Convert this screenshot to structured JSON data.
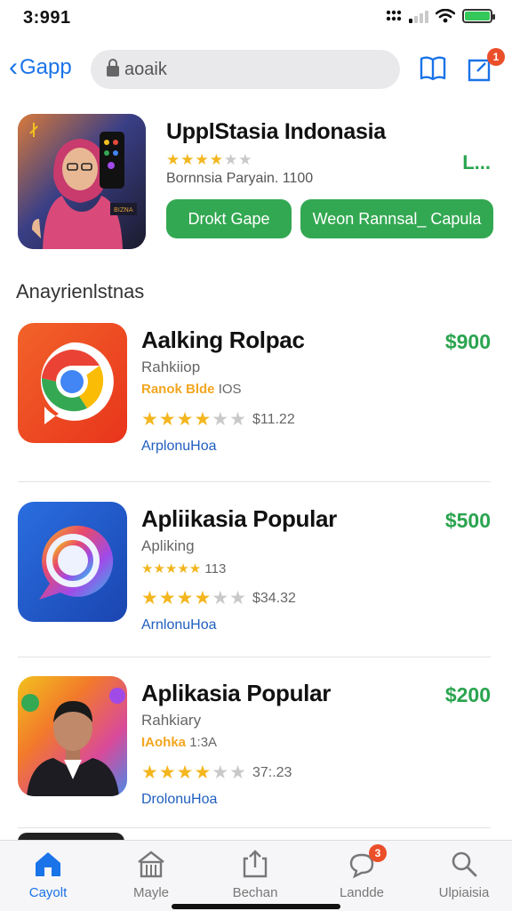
{
  "status_bar": {
    "time": "3:991"
  },
  "nav": {
    "back_label": "Gapp",
    "search_text": "aoaik",
    "cart_badge": "1"
  },
  "featured": {
    "title": "UpplStasia Indonasia",
    "rating": 3.5,
    "subtitle": "Bornnsia Paryain. 1100",
    "price": "L...",
    "button_primary": "Drokt Gape",
    "button_secondary": "Weon Rannsal_ Capula"
  },
  "section_title": "Anayrienlstnas",
  "apps": [
    {
      "name": "Aalking Rolpac",
      "price": "$900",
      "category": "Rahkiiop",
      "tag_highlight": "Ranok Blde",
      "tag_rest": "IOS",
      "rating": 3.5,
      "rating_value": "$11.22",
      "developer": "ArplonuHoa",
      "icon": "chrome-like-icon",
      "colors": {
        "bg": "#f04a26"
      }
    },
    {
      "name": "Apliikasia Popular",
      "price": "$500",
      "category": "Apliking",
      "tag_highlight": "",
      "tag_rest": "113",
      "rating": 3.5,
      "rating_value": "$34.32",
      "developer": "ArnlonuHoa",
      "icon": "chat-swirl-icon",
      "colors": {
        "bg": "#2156c9"
      }
    },
    {
      "name": "Aplikasia Popular",
      "price": "$200",
      "category": "Rahkiary",
      "tag_highlight": "IAohka",
      "tag_rest": "1:3A",
      "rating": 3.5,
      "rating_value": "37:.23",
      "developer": "DrolonuHoa",
      "icon": "portrait-photo-icon",
      "colors": {
        "bg": "#f28b1e"
      }
    }
  ],
  "tabs": [
    {
      "label": "Cayolt",
      "icon": "home-icon",
      "active": true
    },
    {
      "label": "Mayle",
      "icon": "store-icon",
      "active": false
    },
    {
      "label": "Bechan",
      "icon": "share-icon",
      "active": false
    },
    {
      "label": "Landde",
      "icon": "chat-icon",
      "active": false,
      "badge": "3"
    },
    {
      "label": "Ulpiaisia",
      "icon": "search-icon",
      "active": false
    }
  ],
  "colors": {
    "accent": "#1a73e8",
    "green": "#33a852",
    "price": "#2aa44f",
    "star": "#f3b61f",
    "badge": "#ea4f2a"
  }
}
